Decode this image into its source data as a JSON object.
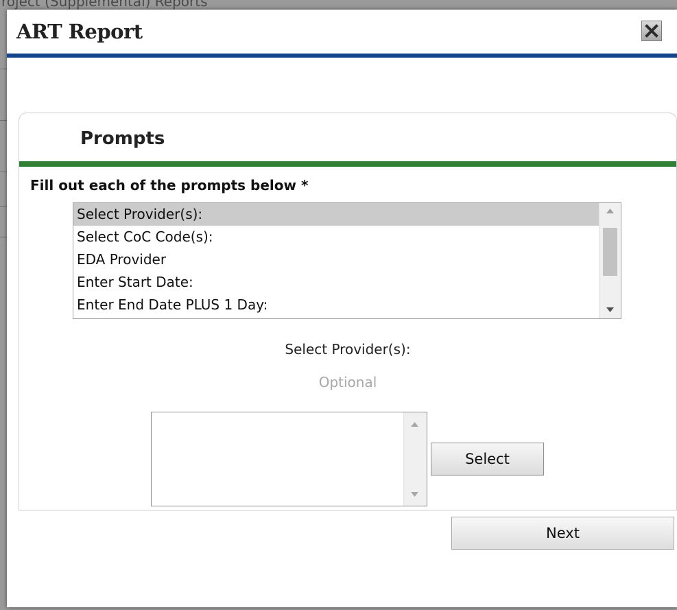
{
  "background_page": {
    "title": "roject (Supplemental) Reports"
  },
  "dialog": {
    "title": "ART Report",
    "close_icon": "close-icon"
  },
  "panel": {
    "title": "Prompts",
    "instruction": "Fill out each of the prompts below *",
    "prompts": [
      {
        "label": "Select Provider(s):",
        "selected": true
      },
      {
        "label": "Select CoC Code(s):",
        "selected": false
      },
      {
        "label": "EDA Provider",
        "selected": false
      },
      {
        "label": "Enter Start Date:",
        "selected": false
      },
      {
        "label": "Enter End Date PLUS 1 Day:",
        "selected": false
      }
    ],
    "current_prompt_label": "Select Provider(s):",
    "optional_label": "Optional",
    "select_button_label": "Select"
  },
  "footer": {
    "next_button_label": "Next"
  },
  "colors": {
    "header_rule": "#12438c",
    "panel_rule": "#2f7f35",
    "selected_item_bg": "#cbcbcb"
  }
}
